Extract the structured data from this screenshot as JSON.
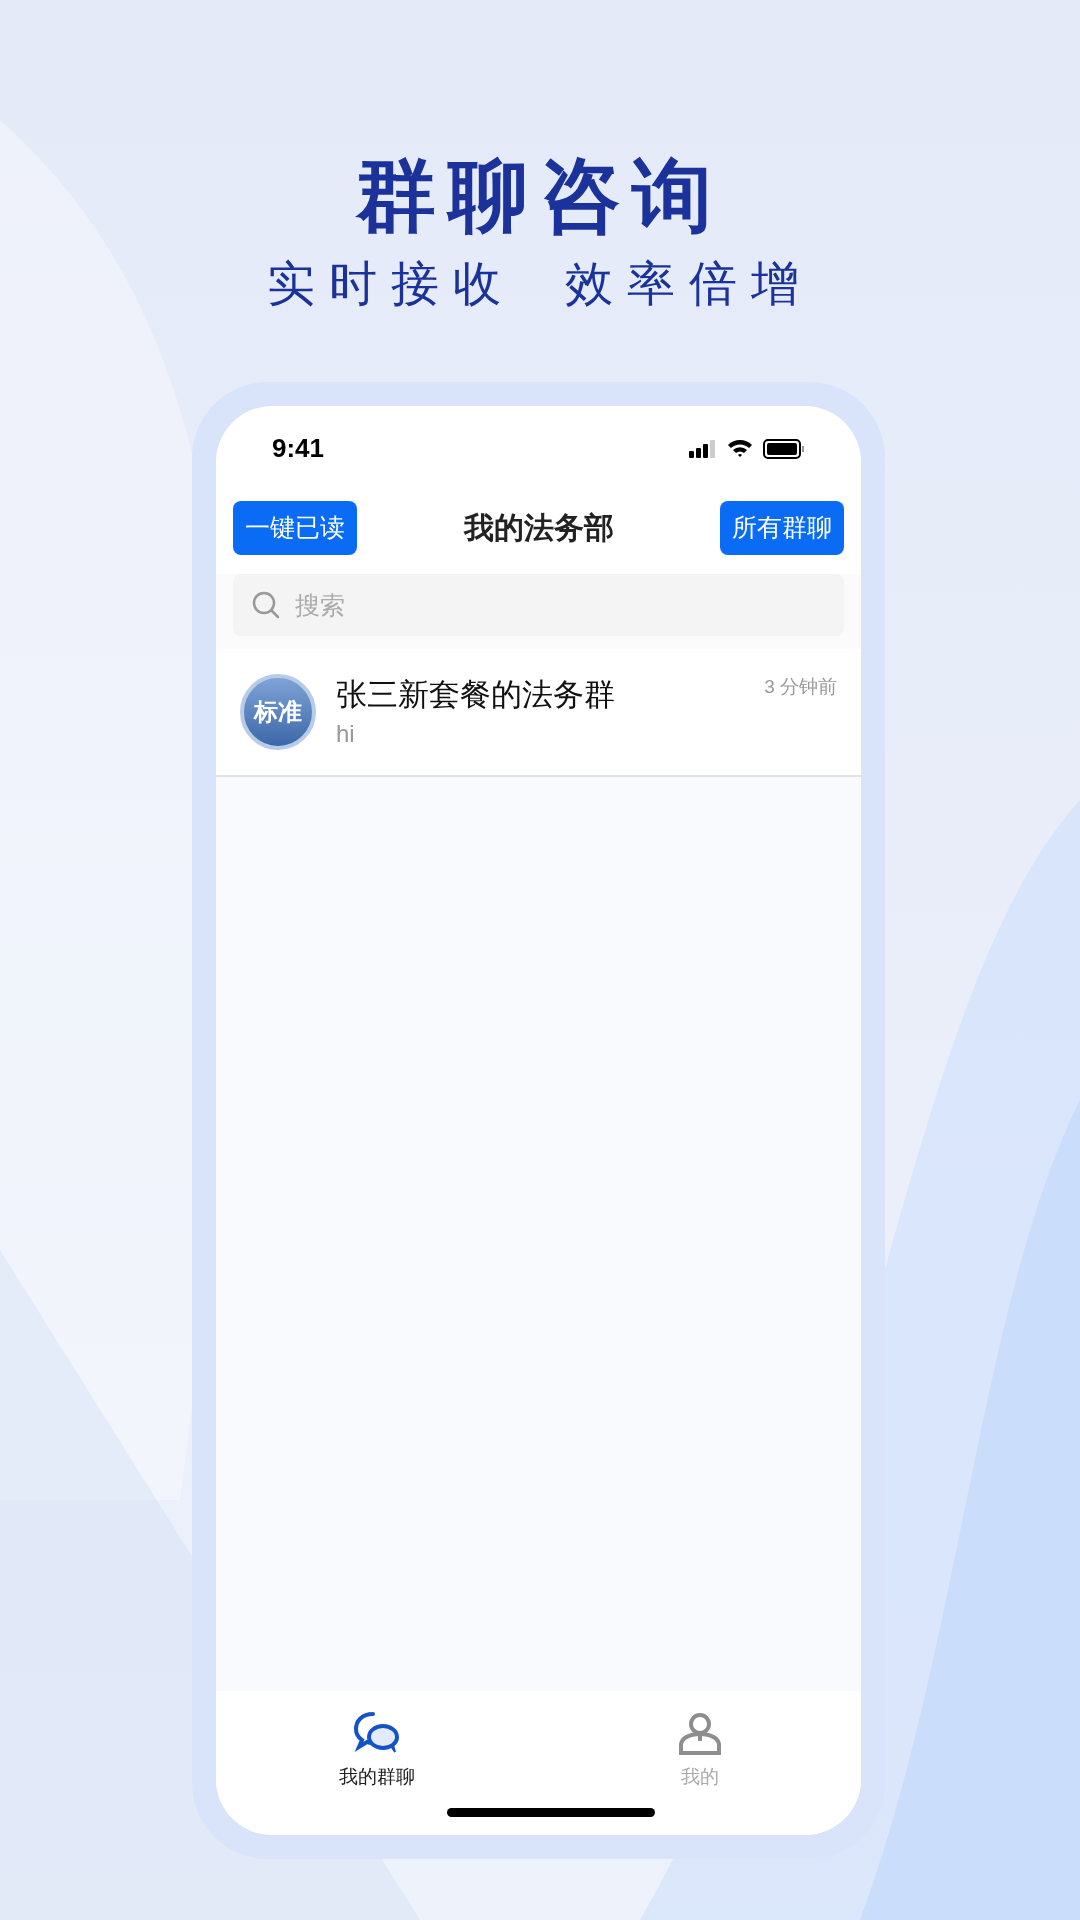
{
  "headline": "群聊咨询",
  "tagline": [
    "实时接收",
    "效率倍增"
  ],
  "status_bar": {
    "time": "9:41"
  },
  "header": {
    "left_button": "一键已读",
    "title": "我的法务部",
    "right_button": "所有群聊"
  },
  "search": {
    "placeholder": "搜索"
  },
  "chats": [
    {
      "avatar_text": "标准",
      "name": "张三新套餐的法务群",
      "time": "3 分钟前",
      "preview": "hi"
    }
  ],
  "tab_bar": [
    {
      "label": "我的群聊",
      "kind": "chat",
      "selected": true
    },
    {
      "label": "我的",
      "kind": "profile",
      "selected": false
    }
  ]
}
